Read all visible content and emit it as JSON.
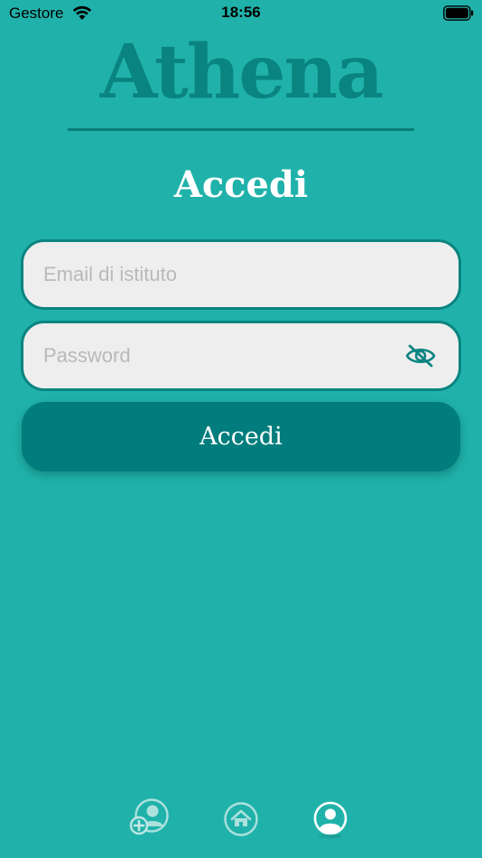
{
  "status_bar": {
    "carrier": "Gestore",
    "time": "18:56"
  },
  "app": {
    "title": "Athena"
  },
  "login": {
    "heading": "Accedi",
    "email_placeholder": "Email di istituto",
    "email_value": "",
    "password_placeholder": "Password",
    "password_value": "",
    "submit_label": "Accedi"
  },
  "tab_bar": {
    "items": [
      {
        "icon": "add-user-icon",
        "active": false
      },
      {
        "icon": "home-icon",
        "active": false
      },
      {
        "icon": "profile-icon",
        "active": true
      }
    ]
  },
  "colors": {
    "background": "#20b2aa",
    "accent": "#027d7d",
    "logo": "#0a8480",
    "field_bg": "#eeeeee",
    "placeholder": "#b9b9b9"
  }
}
